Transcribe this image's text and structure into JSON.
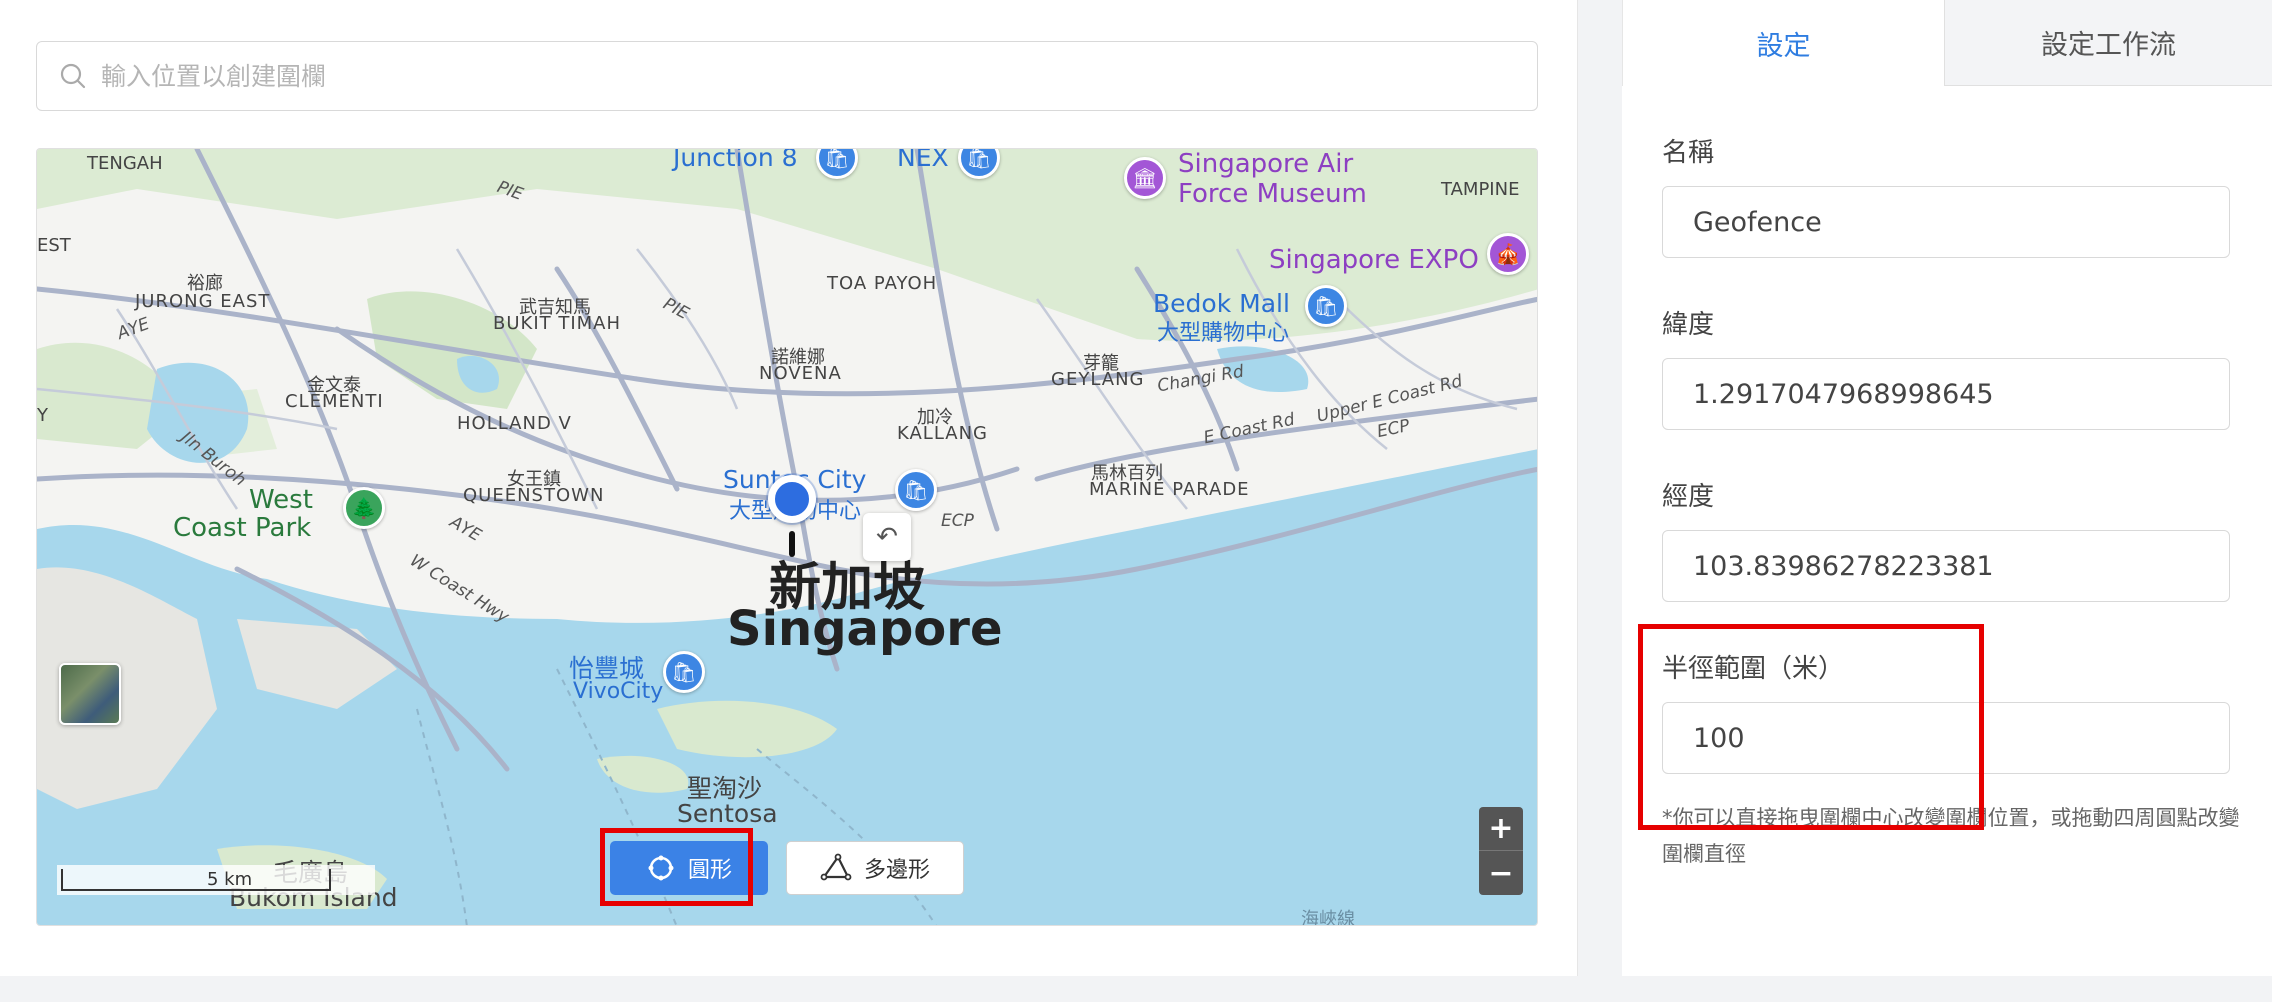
{
  "search": {
    "placeholder": "輸入位置以創建圍欄"
  },
  "map": {
    "labels": {
      "tengah": "TENGAH",
      "est": "EST",
      "y_edge": "Y",
      "junction8": "Junction 8",
      "nex": "NEX",
      "air_museum_1": "Singapore Air",
      "air_museum_2": "Force Museum",
      "tampines": "TAMPINE",
      "expo": "Singapore EXPO",
      "bedok_mall_1": "Bedok Mall",
      "bedok_mall_2": "大型購物中心",
      "yuhua": "裕廊",
      "jurong_east": "JURONG EAST",
      "bukit_timah_cn": "武吉知馬",
      "bukit_timah": "BUKIT TIMAH",
      "toa_payoh": "TOA PAYOH",
      "novena_cn": "諾維娜",
      "novena": "NOVENA",
      "geylang_cn": "芽籠",
      "geylang": "GEYLANG",
      "clementi_cn": "金文泰",
      "clementi": "CLEMENTI",
      "holland": "HOLLAND V",
      "kallang_cn": "加冷",
      "kallang": "KALLANG",
      "queenstown_cn": "女王鎮",
      "queenstown": "QUEENSTOWN",
      "suntec_1": "Suntec City",
      "suntec_2": "大型購物中心",
      "marine_cn": "馬林百列",
      "marine": "MARINE PARADE",
      "west_coast_1": "West",
      "west_coast_2": "Coast Park",
      "singapore_cn": "新加坡",
      "singapore": "Singapore",
      "vivo_cn": "怡豐城",
      "vivo": "VivoCity",
      "sentosa_cn": "聖淘沙",
      "sentosa": "Sentosa",
      "bukom_cn": "毛廣島",
      "bukom": "Bukom Island",
      "pie1": "PIE",
      "pie2": "PIE",
      "aye1": "AYE",
      "aye2": "AYE",
      "ecp1": "ECP",
      "ecp2": "ECP",
      "changi": "Changi Rd",
      "ecr": "E Coast Rd",
      "uecr": "Upper E Coast Rd",
      "jln_buroh": "Jln Buroh",
      "wcoast": "W Coast Hwy",
      "bottom_cn": "海峽線"
    },
    "scale": "5 km",
    "zoom_in": "+",
    "zoom_out": "−",
    "undo": "↶"
  },
  "modes": {
    "circle": "圓形",
    "polygon": "多邊形"
  },
  "tabs": {
    "settings": "設定",
    "workflow": "設定工作流"
  },
  "form": {
    "name_label": "名稱",
    "name_value": "Geofence",
    "lat_label": "緯度",
    "lat_value": "1.2917047968998645",
    "lng_label": "經度",
    "lng_value": "103.83986278223381",
    "radius_label": "半徑範圍（米）",
    "radius_value": "100",
    "note": "*你可以直接拖曳圍欄中心改變圍欄位置，或拖動四周圓點改變圍欄直徑"
  },
  "colors": {
    "accent": "#3b82e6",
    "highlight": "#e60000",
    "water": "#a7d7ec"
  }
}
